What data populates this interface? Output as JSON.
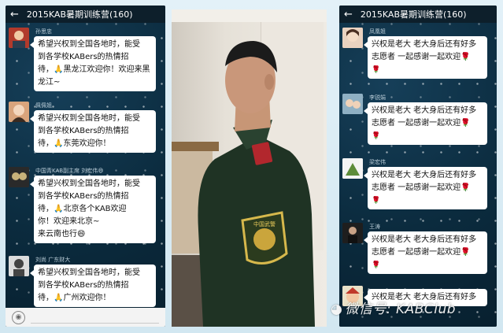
{
  "left_panel": {
    "title": "2015KAB暑期训练营(160)",
    "messages": [
      {
        "name": "孙思忠",
        "lines": [
          "希望兴权到全国各地时，能受",
          "到各学校KABers的热情招",
          "待，🙏黑龙江欢迎你！欢迎来黑龙江~"
        ],
        "avatar_color": "#b23a2c"
      },
      {
        "name": "佩佩姐",
        "lines": [
          "希望兴权到全国各地时，能受",
          "到各学校KABers的热情招",
          "待，🙏东莞欢迎你！"
        ],
        "avatar_color": "#d9a47c"
      },
      {
        "name": "中国青KAB副主席 刘宏伟😄",
        "lines": [
          "希望兴权到全国各地时，能受",
          "到各学校KABers的热情招",
          "待，🙏北京各个KAB欢迎",
          "你！欢迎来北京~",
          "来云南也行😄"
        ],
        "avatar_color": "#333333"
      },
      {
        "name": "刘尚 广东财大",
        "lines": [
          "希望兴权到全国各地时，能受",
          "到各学校KABers的热情招",
          "待，🙏广州欢迎你！"
        ],
        "avatar_color": "#7a7a7a"
      }
    ]
  },
  "right_panel": {
    "title": "2015KAB暑期训练营(160)",
    "messages": [
      {
        "name": "凤凰姐",
        "lines": [
          "兴权是老大 老大身后还有好多",
          "志愿者 一起感谢一起欢迎🌹",
          "🌹"
        ],
        "avatar_color": "#d9a47c"
      },
      {
        "name": "李锐娟",
        "lines": [
          "兴权是老大 老大身后还有好多",
          "志愿者 一起感谢一起欢迎🌹",
          "🌹"
        ],
        "avatar_color": "#6c8fa8"
      },
      {
        "name": "梁宏伟",
        "lines": [
          "兴权是老大 老大身后还有好多",
          "志愿者 一起感谢一起欢迎🌹",
          "🌹"
        ],
        "avatar_color": "#ffffff"
      },
      {
        "name": "王涛",
        "lines": [
          "兴权是老大 老大身后还有好多",
          "志愿者 一起感谢一起欢迎🌹",
          "🌹"
        ],
        "avatar_color": "#222222"
      },
      {
        "name": "",
        "lines": [
          "兴权是老大 老大身后还有好多"
        ],
        "avatar_color": "#c0392b"
      }
    ]
  },
  "watermark": "微信号: KABClub",
  "badge_text": "中国武警"
}
